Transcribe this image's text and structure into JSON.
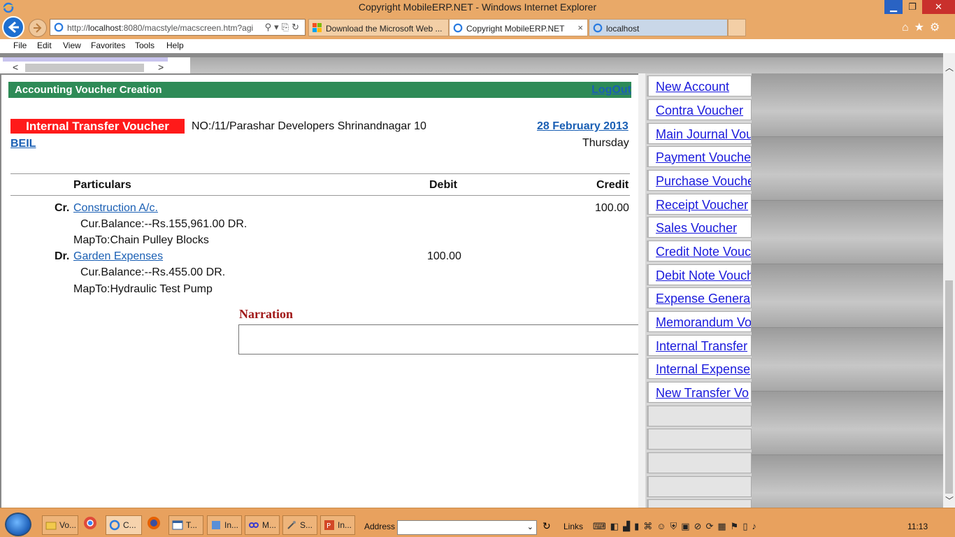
{
  "window": {
    "title": "Copyright MobileERP.NET - Windows Internet Explorer"
  },
  "addressbar": {
    "url_prefix": "http://",
    "url_host": "localhost",
    "url_rest": ":8080/macstyle/macscreen.htm?agi"
  },
  "tabs": [
    {
      "label": "Download the Microsoft Web ...",
      "icon": "msn-icon"
    },
    {
      "label": "Copyright MobileERP.NET",
      "icon": "ie-icon",
      "close": "×"
    },
    {
      "label": "localhost",
      "icon": "ie-icon"
    }
  ],
  "menu": [
    "File",
    "Edit",
    "View",
    "Favorites",
    "Tools",
    "Help"
  ],
  "header": {
    "title": "Accounting Voucher Creation",
    "logout": "LogOut"
  },
  "voucher": {
    "type": "Internal Transfer Voucher",
    "number": "NO:/11/Parashar Developers Shrinandnagar 10",
    "date": "28 February 2013",
    "day": "Thursday",
    "company": "BEIL"
  },
  "table": {
    "columns": {
      "particulars": "Particulars",
      "debit": "Debit",
      "credit": "Credit"
    },
    "entries": [
      {
        "side": "Cr.",
        "account": "Construction A/c.",
        "balance": "Cur.Balance:--Rs.155,961.00 DR.",
        "mapto": "MapTo:Chain Pulley Blocks",
        "debit": "",
        "credit": "100.00"
      },
      {
        "side": "Dr.",
        "account": "Garden Expenses",
        "balance": "Cur.Balance:--Rs.455.00 DR.",
        "mapto": "MapTo:Hydraulic Test Pump",
        "debit": "100.00",
        "credit": ""
      }
    ]
  },
  "narration": {
    "label": "Narration",
    "value": ""
  },
  "sidebar": {
    "items": [
      "New Account",
      "Contra Voucher",
      "Main Journal Vou",
      "Payment Vouche",
      "Purchase Vouche",
      "Receipt Voucher",
      "Sales Voucher",
      "Credit Note Vouc",
      "Debit Note Vouch",
      "Expense Genera",
      "Memorandum Vo",
      "Internal Transfer",
      "Internal Expense",
      "New Transfer Vo"
    ]
  },
  "taskbar": {
    "buttons": [
      {
        "label": "Vo...",
        "icon": "folder-icon"
      },
      {
        "label": "C...",
        "icon": "ie-icon"
      },
      {
        "label": "T...",
        "icon": "window-icon"
      },
      {
        "label": "In...",
        "icon": "app-icon"
      },
      {
        "label": "M...",
        "icon": "link-icon"
      },
      {
        "label": "S...",
        "icon": "tools-icon"
      },
      {
        "label": "In...",
        "icon": "powerpoint-icon"
      }
    ],
    "address_label": "Address",
    "links_label": "Links",
    "clock": "11:13"
  },
  "colors": {
    "titlebar": "#e9a968",
    "header_green": "#2e8b57",
    "badge_red": "#ff1a1a",
    "link_blue": "#1a5fb4",
    "narration_red": "#a01818"
  }
}
